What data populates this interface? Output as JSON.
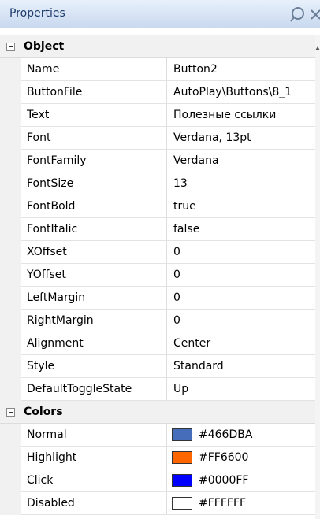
{
  "panel": {
    "title": "Properties"
  },
  "categories": [
    {
      "label": "Object",
      "rows": [
        {
          "name": "Name",
          "value": "Button2"
        },
        {
          "name": "ButtonFile",
          "value": "AutoPlay\\Buttons\\8_1"
        },
        {
          "name": "Text",
          "value": "Полезные ссылки"
        },
        {
          "name": "Font",
          "value": "Verdana, 13pt"
        },
        {
          "name": "FontFamily",
          "value": "Verdana"
        },
        {
          "name": "FontSize",
          "value": "13"
        },
        {
          "name": "FontBold",
          "value": "true"
        },
        {
          "name": "FontItalic",
          "value": "false"
        },
        {
          "name": "XOffset",
          "value": "0"
        },
        {
          "name": "YOffset",
          "value": "0"
        },
        {
          "name": "LeftMargin",
          "value": "0"
        },
        {
          "name": "RightMargin",
          "value": "0"
        },
        {
          "name": "Alignment",
          "value": "Center"
        },
        {
          "name": "Style",
          "value": "Standard"
        },
        {
          "name": "DefaultToggleState",
          "value": "Up"
        }
      ]
    },
    {
      "label": "Colors",
      "rows": [
        {
          "name": "Normal",
          "value": "#466DBA",
          "color": "#466DBA"
        },
        {
          "name": "Highlight",
          "value": "#FF6600",
          "color": "#FF6600"
        },
        {
          "name": "Click",
          "value": "#0000FF",
          "color": "#0000FF"
        },
        {
          "name": "Disabled",
          "value": "#FFFFFF",
          "color": "#FFFFFF"
        }
      ]
    }
  ]
}
